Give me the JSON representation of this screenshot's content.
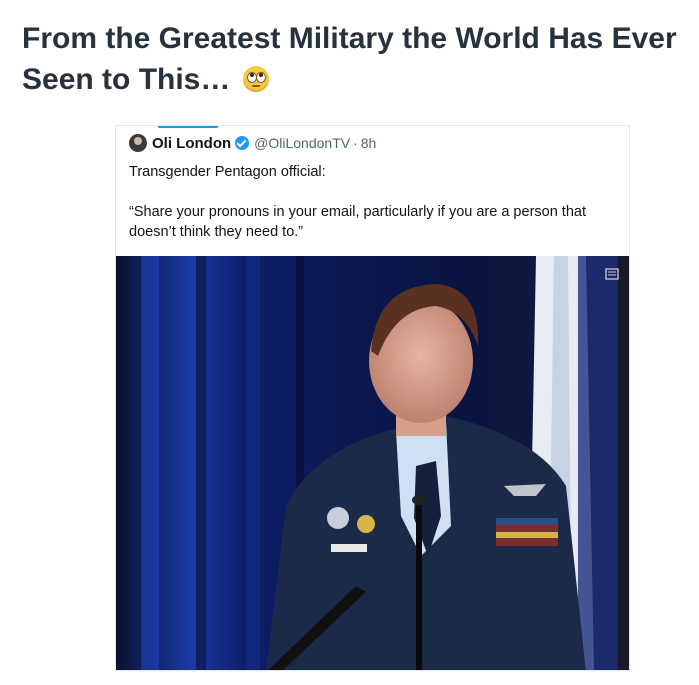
{
  "headline": {
    "text": "From the Greatest Military the World Has Ever Seen to This…",
    "emoji": "rolling-eyes-emoji"
  },
  "tweet": {
    "author_name": "Oli London",
    "handle": "@OliLondonTV",
    "separator": "·",
    "time": "8h",
    "text": "Transgender Pentagon official:",
    "quote": "“Share your pronouns in your email, particularly if you are a person that doesn’t think they need to.”"
  },
  "colors": {
    "headline": "#28323d",
    "verified": "#1d9bf0",
    "uniform": "#1c2a4a",
    "backdrop": "#0b1a4a"
  }
}
